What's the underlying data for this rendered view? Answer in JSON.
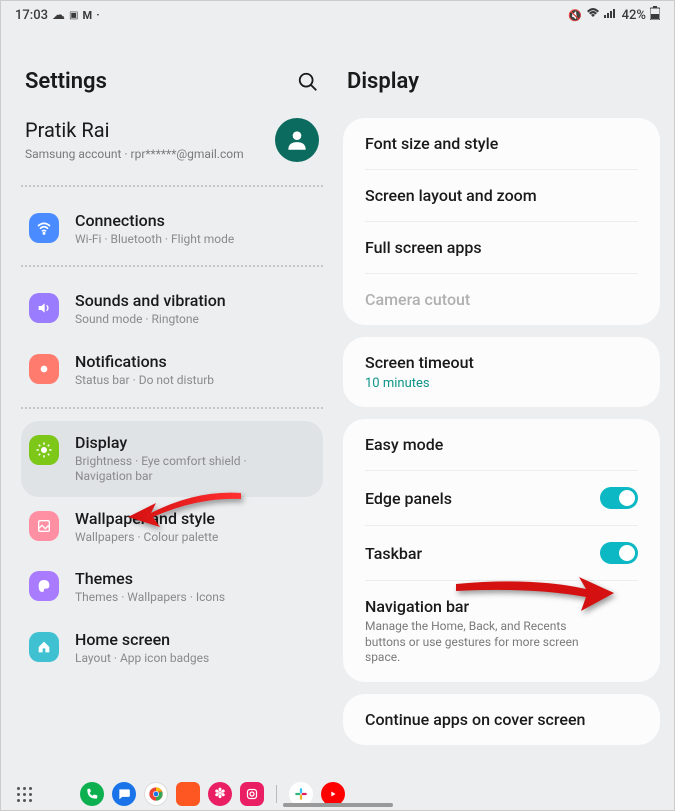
{
  "status": {
    "time": "17:03",
    "battery": "42%"
  },
  "left": {
    "title": "Settings",
    "account": {
      "name": "Pratik Rai",
      "sub": "Samsung account  ·  rpr******@gmail.com"
    },
    "items": [
      {
        "title": "Connections",
        "sub": "Wi-Fi  ·  Bluetooth  ·  Flight mode",
        "color": "#4a8cff",
        "icon": "wifi"
      },
      {
        "title": "Sounds and vibration",
        "sub": "Sound mode  ·  Ringtone",
        "color": "#9a7cff",
        "icon": "sound"
      },
      {
        "title": "Notifications",
        "sub": "Status bar  ·  Do not disturb",
        "color": "#ff7b6e",
        "icon": "notif"
      },
      {
        "title": "Display",
        "sub": "Brightness  ·  Eye comfort shield  ·  Navigation bar",
        "color": "#7cc718",
        "icon": "display"
      },
      {
        "title": "Wallpaper and style",
        "sub": "Wallpapers  ·  Colour palette",
        "color": "#ff8fa3",
        "icon": "wallpaper"
      },
      {
        "title": "Themes",
        "sub": "Themes  ·  Wallpapers  ·  Icons",
        "color": "#a97cff",
        "icon": "themes"
      },
      {
        "title": "Home screen",
        "sub": "Layout  ·  App icon badges",
        "color": "#3fc1d1",
        "icon": "home"
      }
    ]
  },
  "right": {
    "title": "Display",
    "card1": [
      {
        "title": "Font size and style"
      },
      {
        "title": "Screen layout and zoom"
      },
      {
        "title": "Full screen apps"
      },
      {
        "title": "Camera cutout",
        "disabled": true
      }
    ],
    "timeout": {
      "title": "Screen timeout",
      "value": "10 minutes"
    },
    "card3": {
      "easy": "Easy mode",
      "edge": "Edge panels",
      "taskbar": "Taskbar",
      "nav": "Navigation bar",
      "nav_sub": "Manage the Home, Back, and Recents buttons or use gestures for more screen space."
    },
    "cont": "Continue apps on cover screen"
  }
}
